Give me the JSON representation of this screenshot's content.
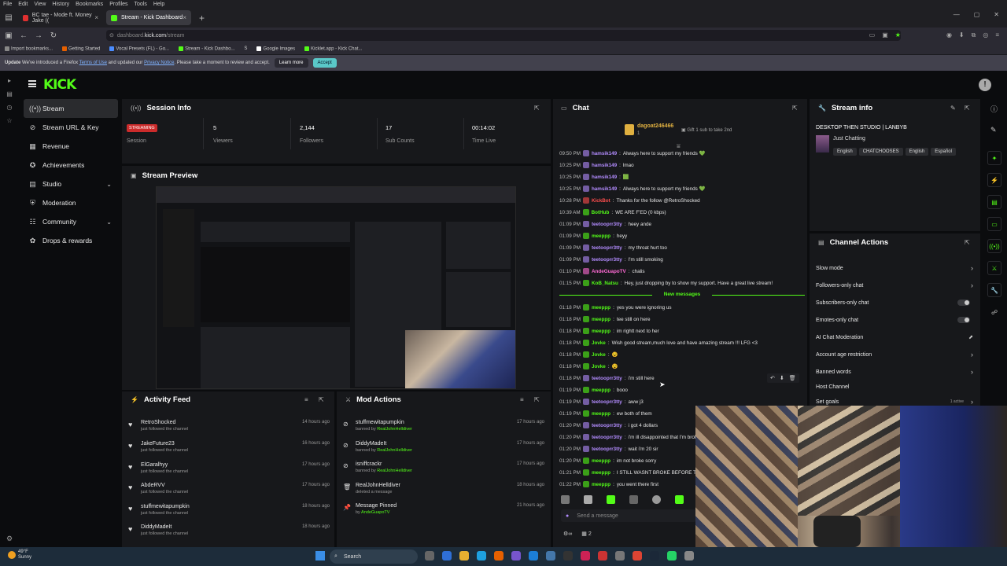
{
  "browser": {
    "menu": [
      "File",
      "Edit",
      "View",
      "History",
      "Bookmarks",
      "Profiles",
      "Tools",
      "Help"
    ],
    "tabs": [
      {
        "label": "BC tae - Mode ft. Money Jake (("
      },
      {
        "label": "Stream - Kick Dashboard"
      }
    ],
    "url_prefix": "dashboard.",
    "url_host": "kick.com",
    "url_path": "/stream",
    "bookmarks": [
      "Import bookmarks...",
      "Getting Started",
      "Vocal Presets (FL) - Go...",
      "Stream - Kick Dashbo...",
      "S",
      "Google Images",
      "Kicklet.app - Kick Chat..."
    ],
    "notice": {
      "bold": "Update",
      "text1": "We've introduced a Firefox",
      "link1": "Terms of Use",
      "text2": "and updated our",
      "link2": "Privacy Notice",
      "text3": ". Please take a moment to review and accept.",
      "learn": "Learn more",
      "accept": "Accept"
    }
  },
  "sidebar": {
    "items": [
      {
        "label": "Stream"
      },
      {
        "label": "Stream URL & Key"
      },
      {
        "label": "Revenue"
      },
      {
        "label": "Achievements"
      },
      {
        "label": "Studio"
      },
      {
        "label": "Moderation"
      },
      {
        "label": "Community"
      },
      {
        "label": "Drops & rewards"
      }
    ]
  },
  "session": {
    "title": "Session Info",
    "live_badge": "STREAMING",
    "session_label": "Session",
    "viewers": "5",
    "viewers_label": "Viewers",
    "followers": "2,144",
    "followers_label": "Followers",
    "subs": "17",
    "subs_label": "Sub Counts",
    "time": "00:14:02",
    "time_label": "Time Live"
  },
  "preview": {
    "title": "Stream Preview"
  },
  "activity": {
    "title": "Activity Feed",
    "items": [
      {
        "name": "RetroShocked",
        "sub": "just followed the channel",
        "time": "14 hours ago"
      },
      {
        "name": "JakeFuture23",
        "sub": "just followed the channel",
        "time": "16 hours ago"
      },
      {
        "name": "ElGaralhyy",
        "sub": "just followed the channel",
        "time": "17 hours ago"
      },
      {
        "name": "AbdeRVV",
        "sub": "just followed the channel",
        "time": "17 hours ago"
      },
      {
        "name": "stuffmewitapumpkin",
        "sub": "just followed the channel",
        "time": "18 hours ago"
      },
      {
        "name": "DiddyMadeIt",
        "sub": "just followed the channel",
        "time": "18 hours ago"
      }
    ]
  },
  "mod": {
    "title": "Mod Actions",
    "items": [
      {
        "name": "stuffmewitapumpkin",
        "pre": "banned by",
        "by": "RealJohnHelldiver",
        "time": "17 hours ago"
      },
      {
        "name": "DiddyMadeIt",
        "pre": "banned by",
        "by": "RealJohnHelldiver",
        "time": "17 hours ago"
      },
      {
        "name": "isniffcrackr",
        "pre": "banned by",
        "by": "RealJohnHelldiver",
        "time": "17 hours ago"
      },
      {
        "name": "RealJohnHelldiver",
        "pre": "deleted a message",
        "by": "",
        "time": "18 hours ago"
      },
      {
        "name": "Message Pinned",
        "pre": "by",
        "by": "AndeGuapoTV",
        "time": "21 hours ago"
      }
    ]
  },
  "chat": {
    "title": "Chat",
    "gifter": "dagoat246466",
    "gifter_count": "1",
    "gift_text": "Gift 1 sub to take 2nd",
    "new_messages": "New messages",
    "input_placeholder": "Send a message",
    "footer_count": "2",
    "colors": {
      "green": "#53fc18",
      "purple": "#b38cff",
      "red": "#ff4d4d",
      "pink": "#ff6ad5"
    },
    "messages": [
      {
        "time": "09:50 PM",
        "user": "hamsik149",
        "color": "#b38cff",
        "text": "Always here to support my friends 💚"
      },
      {
        "time": "10:25 PM",
        "user": "hamsik149",
        "color": "#b38cff",
        "text": "lmao"
      },
      {
        "time": "10:25 PM",
        "user": "hamsik149",
        "color": "#b38cff",
        "text": "🟩"
      },
      {
        "time": "10:25 PM",
        "user": "hamsik149",
        "color": "#b38cff",
        "text": "Always here to support my friends 💚"
      },
      {
        "time": "10:28 PM",
        "user": "KickBot",
        "color": "#ff4d4d",
        "text": "Thanks for the follow @RetroShocked"
      },
      {
        "time": "10:39 AM",
        "user": "BotHub",
        "color": "#53fc18",
        "text": "WE ARE F'ED (0 kbps)"
      },
      {
        "time": "01:09 PM",
        "user": "teetooprr3tty",
        "color": "#b38cff",
        "text": "heey ande"
      },
      {
        "time": "01:09 PM",
        "user": "meeppp",
        "color": "#53fc18",
        "text": "heyy"
      },
      {
        "time": "01:09 PM",
        "user": "teetooprr3tty",
        "color": "#b38cff",
        "text": "my throat hurt too"
      },
      {
        "time": "01:09 PM",
        "user": "teetooprr3tty",
        "color": "#b38cff",
        "text": "I'm still smoking"
      },
      {
        "time": "01:10 PM",
        "user": "AndeGuapoTV",
        "color": "#ff6ad5",
        "text": "chalis"
      },
      {
        "time": "01:15 PM",
        "user": "KoB_Natsu",
        "color": "#53fc18",
        "text": "Hey, just dropping by to show my support. Have a great live stream!"
      },
      {
        "time": "01:18 PM",
        "user": "meeppp",
        "color": "#53fc18",
        "text": "yes you were ignoring us"
      },
      {
        "time": "01:18 PM",
        "user": "meeppp",
        "color": "#53fc18",
        "text": "tee still on here"
      },
      {
        "time": "01:18 PM",
        "user": "meeppp",
        "color": "#53fc18",
        "text": "im rightt next to her"
      },
      {
        "time": "01:18 PM",
        "user": "Jovke",
        "color": "#53fc18",
        "text": "Wish good stream,much love and have amazing stream !!! LFG <3"
      },
      {
        "time": "01:18 PM",
        "user": "Jovke",
        "color": "#53fc18",
        "text": "😵"
      },
      {
        "time": "01:18 PM",
        "user": "Jovke",
        "color": "#53fc18",
        "text": "😵"
      },
      {
        "time": "01:18 PM",
        "user": "teetooprr3tty",
        "color": "#b38cff",
        "text": "i'm still here"
      },
      {
        "time": "01:19 PM",
        "user": "meeppp",
        "color": "#53fc18",
        "text": "booo"
      },
      {
        "time": "01:19 PM",
        "user": "teetooprr3tty",
        "color": "#b38cff",
        "text": "aww j3"
      },
      {
        "time": "01:19 PM",
        "user": "meeppp",
        "color": "#53fc18",
        "text": "ew both of them"
      },
      {
        "time": "01:20 PM",
        "user": "teetooprr3tty",
        "color": "#b38cff",
        "text": "i got 4 dollars"
      },
      {
        "time": "01:20 PM",
        "user": "teetooprr3tty",
        "color": "#b38cff",
        "text": "i'm ill disappointed that I'm broke"
      },
      {
        "time": "01:20 PM",
        "user": "teetooprr3tty",
        "color": "#b38cff",
        "text": "wait i'm 20 sir"
      },
      {
        "time": "01:20 PM",
        "user": "meeppp",
        "color": "#53fc18",
        "text": "im not broke sorry"
      },
      {
        "time": "01:21 PM",
        "user": "meeppp",
        "color": "#53fc18",
        "text": "I STILL WASNT BROKE BEFORE TH"
      },
      {
        "time": "01:22 PM",
        "user": "meeppp",
        "color": "#53fc18",
        "text": "you went there first"
      }
    ]
  },
  "streaminfo": {
    "title": "Stream info",
    "stream_title": "DESKTOP THEN STUDIO | LANBYB",
    "category": "Just Chatting",
    "tags": [
      "English",
      "CHATCHOOSES",
      "English",
      "Español"
    ]
  },
  "channel_actions": {
    "title": "Channel Actions",
    "items": [
      {
        "label": "Slow mode",
        "control": "arrow"
      },
      {
        "label": "Followers-only chat",
        "control": "arrow"
      },
      {
        "label": "Subscribers-only chat",
        "control": "toggle"
      },
      {
        "label": "Emotes-only chat",
        "control": "toggle"
      },
      {
        "label": "AI Chat Moderation",
        "control": "chart"
      },
      {
        "label": "Account age restriction",
        "control": "arrow"
      },
      {
        "label": "Banned words",
        "control": "arrow"
      },
      {
        "label": "Host Channel",
        "control": "none"
      },
      {
        "label": "Set goals",
        "control": "arrow",
        "badge": "1 active"
      }
    ]
  },
  "taskbar": {
    "temp": "49°F",
    "weather": "Sunny",
    "search": "Search"
  }
}
